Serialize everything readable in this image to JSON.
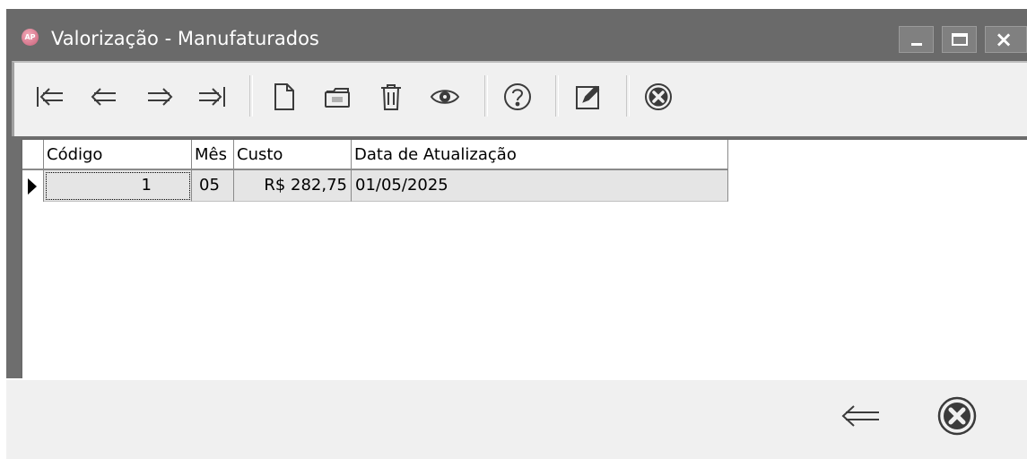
{
  "window": {
    "app_icon_text": "AP",
    "title": "Valorização - Manufaturados",
    "controls": {
      "minimize": "minimize",
      "maximize": "maximize",
      "close": "×"
    }
  },
  "toolbar": {
    "icons": [
      "first-record-icon",
      "previous-record-icon",
      "next-record-icon",
      "last-record-icon",
      "new-document-icon",
      "open-folder-icon",
      "trash-icon",
      "view-eye-icon",
      "help-icon",
      "edit-icon",
      "close-circle-icon"
    ]
  },
  "grid": {
    "columns": [
      "Código",
      "Mês",
      "Custo",
      "Data de Atualização"
    ],
    "rows": [
      {
        "codigo": "1",
        "mes": "05",
        "custo": "R$ 282,75",
        "data": "01/05/2025"
      }
    ]
  },
  "footer": {
    "icons": [
      "back-arrow-icon",
      "close-circle-icon"
    ]
  },
  "colors": {
    "titlebar": "#6a6a6a",
    "panel": "#f0f0f0",
    "row_selected": "#e5e5e5",
    "icon": "#3b3b3b"
  }
}
